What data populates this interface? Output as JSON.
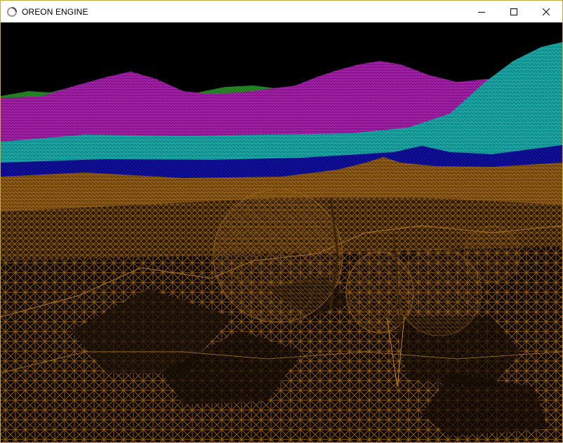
{
  "window": {
    "title": "OREON ENGINE",
    "app_icon": "loading-ring-icon",
    "controls": [
      "minimize-icon",
      "maximize-icon",
      "close-icon"
    ]
  },
  "scene": {
    "type": "wireframe-terrain-render",
    "colors": {
      "sky": "#000000",
      "far_hills_green": "#1f8a1f",
      "hills_magenta": "#a01aa8",
      "band_cyan": "#1aa8a8",
      "band_blue": "#1010a0",
      "ground_brown": "#8a5410"
    }
  }
}
